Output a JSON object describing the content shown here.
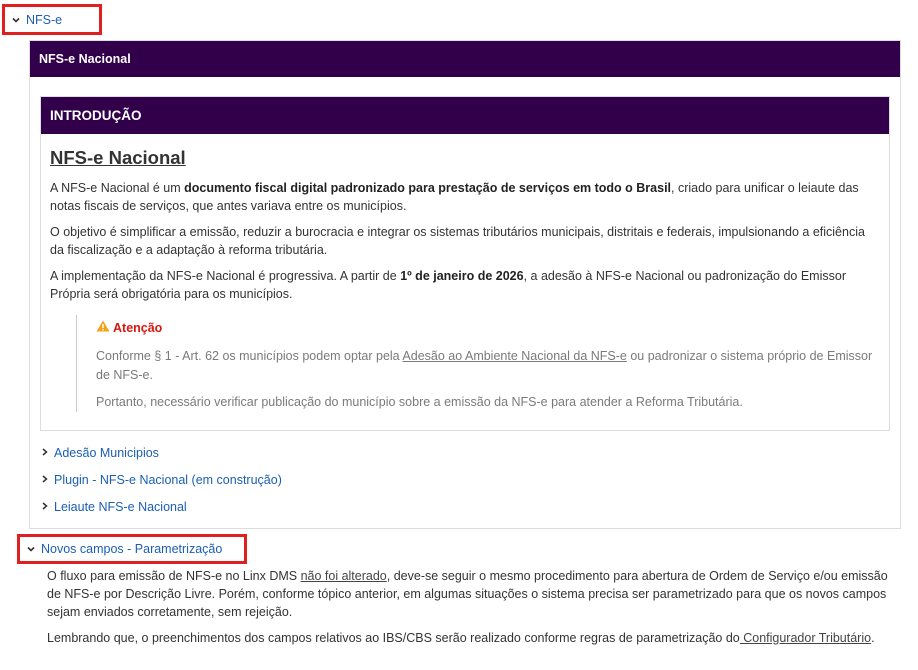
{
  "nfse_toggle": {
    "label": "NFS-e"
  },
  "outer_panel": {
    "header": "NFS-e Nacional"
  },
  "intro": {
    "header": "INTRODUÇÃO",
    "title": "NFS-e Nacional",
    "p1_a": "A NFS-e Nacional é um ",
    "p1_b": "documento fiscal digital padronizado para prestação de serviços em todo o Brasil",
    "p1_c": ", criado para unificar o leiaute das notas fiscais de serviços, que antes variava entre os municípios.",
    "p2": "O objetivo é simplificar a emissão, reduzir a burocracia e integrar os sistemas tributários municipais, distritais e federais, impulsionando a eficiência da fiscalização e a adaptação à reforma tributária.",
    "p3_a": "A implementação da NFS-e Nacional é progressiva. A partir de ",
    "p3_b": "1º de janeiro de 2026",
    "p3_c": ", a adesão à NFS-e Nacional ou padronização do Emissor Própria será obrigatória para os municípios.",
    "attention": {
      "icon": "warning-icon",
      "title": "Atenção",
      "line1_a": "Conforme § 1 - Art. 62 os municípios podem optar pela ",
      "line1_link": "Adesão ao Ambiente Nacional da NFS-e",
      "line1_b": " ou padronizar o sistema próprio de Emissor de NFS-e.",
      "line2": "Portanto, necessário verificar publicação do município sobre a emissão da NFS-e para atender a Reforma Tributária."
    }
  },
  "sub_links": [
    {
      "label": "Adesão Municipios"
    },
    {
      "label": "Plugin - NFS-e Nacional (em construção)"
    },
    {
      "label": "Leiaute NFS-e Nacional"
    }
  ],
  "novos_toggle": {
    "label": "Novos campos - Parametrização"
  },
  "bottom": {
    "p1_a": "O fluxo para  emissão de NFS-e no Linx DMS ",
    "p1_link": "não foi alterado",
    "p1_b": ", deve-se seguir o mesmo procedimento para abertura de Ordem de Serviço e/ou emissão de NFS-e por Descrição Livre. Porém, conforme tópico anterior, em algumas situações o sistema precisa ser parametrizado para que os novos campos sejam enviados corretamente, sem rejeição.",
    "p2_a": "Lembrando que, o preenchimentos dos campos relativos ao IBS/CBS serão realizado conforme regras de parametrização do",
    "p2_link": " Configurador Tributário",
    "p2_b": "."
  },
  "colors": {
    "header_bg": "#32004b",
    "link": "#1a5fb4",
    "highlight_border": "#e0201e",
    "attention": "#d8180e"
  }
}
